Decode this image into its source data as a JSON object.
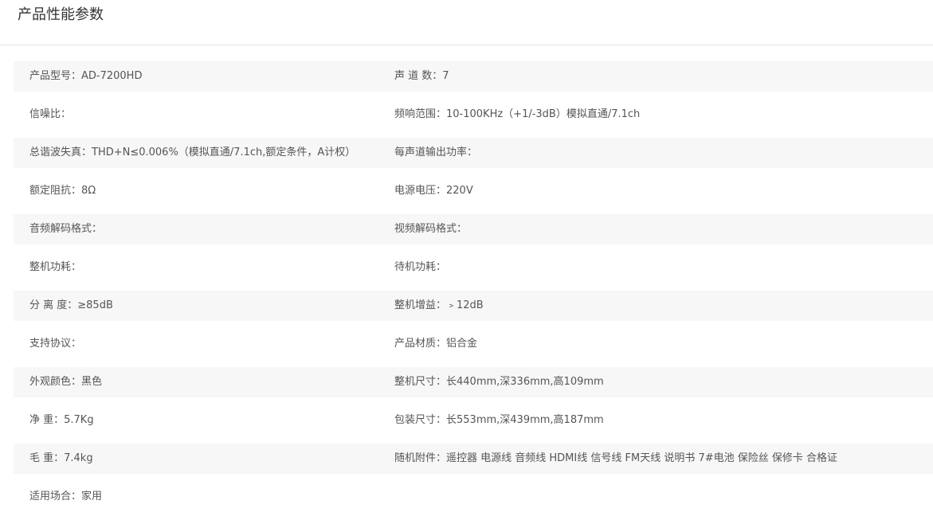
{
  "section_title": "产品性能参数",
  "rows": [
    {
      "left": "产品型号：AD-7200HD",
      "right": "声 道 数：7"
    },
    {
      "left": "信噪比：",
      "right": "频响范围：10-100KHz（+1/-3dB）模拟直通/7.1ch"
    },
    {
      "left": "总谐波失真：THD+N≤0.006%（模拟直通/7.1ch,额定条件，A计权）",
      "right": "每声道输出功率："
    },
    {
      "left": "额定阻抗：8Ω",
      "right": "电源电压：220V"
    },
    {
      "left": "音频解码格式：",
      "right": "视频解码格式："
    },
    {
      "left": "整机功耗：",
      "right": "待机功耗："
    },
    {
      "left": "分 离 度：≥85dB",
      "right": "整机增益：﹥12dB"
    },
    {
      "left": "支持协议：",
      "right": "产品材质：铝合金"
    },
    {
      "left": "外观颜色：黑色",
      "right": "整机尺寸：长440mm,深336mm,高109mm"
    },
    {
      "left": "净 重：5.7Kg",
      "right": "包装尺寸：长553mm,深439mm,高187mm"
    },
    {
      "left": "毛 重：7.4kg",
      "right": "随机附件：遥控器 电源线 音频线 HDMI线 信号线 FM天线 说明书 7#电池 保险丝 保修卡 合格证"
    },
    {
      "left": "适用场合：家用",
      "right": ""
    }
  ]
}
